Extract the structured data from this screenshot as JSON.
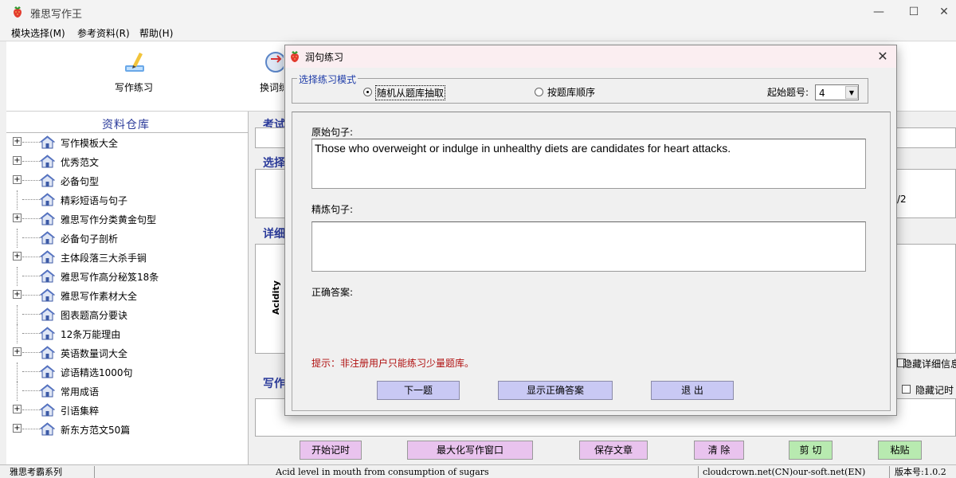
{
  "window": {
    "title": "雅思写作王",
    "controls": {
      "minimize": "—",
      "maximize": "☐",
      "close": "✕"
    }
  },
  "menu": [
    {
      "label": "模块选择(M)"
    },
    {
      "label": "参考资料(R)"
    },
    {
      "label": "帮助(H)"
    }
  ],
  "toolbar": {
    "items": [
      {
        "label": "写作练习",
        "icon": "pen-writing-icon"
      },
      {
        "label": "换词练",
        "icon": "swap-words-icon"
      }
    ]
  },
  "left_panel": {
    "title": "资料仓库",
    "items": [
      {
        "label": "写作模板大全",
        "expandable": true
      },
      {
        "label": "优秀范文",
        "expandable": true
      },
      {
        "label": "必备句型",
        "expandable": true
      },
      {
        "label": "精彩短语与句子",
        "expandable": false
      },
      {
        "label": "雅思写作分类黄金句型",
        "expandable": true
      },
      {
        "label": "必备句子剖析",
        "expandable": false
      },
      {
        "label": "主体段落三大杀手锏",
        "expandable": true
      },
      {
        "label": "雅思写作高分秘笈18条",
        "expandable": false
      },
      {
        "label": "雅思写作素材大全",
        "expandable": true
      },
      {
        "label": "图表题高分要诀",
        "expandable": false
      },
      {
        "label": "12条万能理由",
        "expandable": false
      },
      {
        "label": "英语数量词大全",
        "expandable": true
      },
      {
        "label": "谚语精选1000句",
        "expandable": false
      },
      {
        "label": "常用成语",
        "expandable": false
      },
      {
        "label": "引语集粹",
        "expandable": true
      },
      {
        "label": "新东方范文50篇",
        "expandable": true
      }
    ]
  },
  "background": {
    "section_kao": "考试",
    "section_xuan": "选择",
    "section_xiang": "详细",
    "section_xie": "写作",
    "page_fraction": "/2",
    "chart_axis_fragment": "Acidity",
    "hide_detail_label": "隐藏详细信息",
    "hide_record_label": "隐藏记时"
  },
  "bottom_buttons": [
    {
      "label": "开始记时"
    },
    {
      "label": "最大化写作窗口"
    },
    {
      "label": "保存文章"
    },
    {
      "label": "清 除"
    },
    {
      "label": "剪 切"
    },
    {
      "label": "粘贴"
    }
  ],
  "status": {
    "series": "雅思考霸系列",
    "topic": "Acid level in mouth from consumption of sugars",
    "site": "cloudcrown.net(CN)our-soft.net(EN)",
    "version": "版本号:1.0.2"
  },
  "dialog": {
    "title": "润句练习",
    "close": "✕",
    "mode_group": {
      "legend": "选择练习模式",
      "options": [
        {
          "label": "随机从题库抽取",
          "selected": true
        },
        {
          "label": "按题库顺序",
          "selected": false
        }
      ],
      "start_label": "起始题号:",
      "start_value": "4",
      "arrow": "▼"
    },
    "original_label": "原始句子:",
    "original_text": "Those who overweight or indulge in unhealthy diets are candidates for heart attacks.",
    "refined_label": "精炼句子:",
    "refined_text": "",
    "answer_label": "正确答案:",
    "hint": "提示：非注册用户只能练习少量题库。",
    "buttons": {
      "next": "下一题",
      "show_answer": "显示正确答案",
      "exit": "退 出"
    }
  },
  "colors": {
    "dialog_title_bg": "#fbeef1",
    "bottom_button_pink": "#e9c3ee",
    "bottom_button_green": "#b8eab0",
    "dialog_button_blue": "#c9c9f4",
    "hint_red": "#b01010",
    "legend_blue": "#1e3ca8"
  }
}
